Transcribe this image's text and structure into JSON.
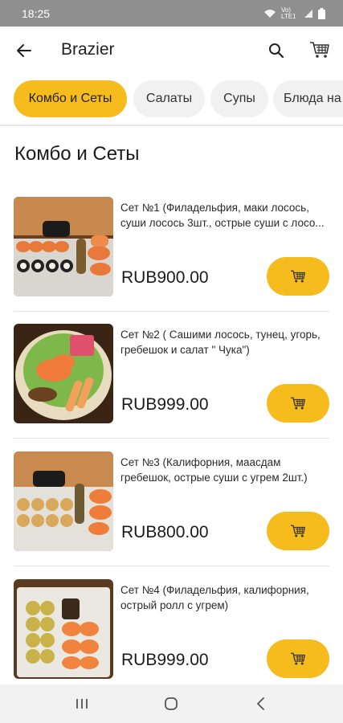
{
  "status": {
    "time": "18:25",
    "network": "Vo) LTE1"
  },
  "header": {
    "title": "Brazier"
  },
  "categories": [
    {
      "label": "Комбо и Сеты",
      "active": true
    },
    {
      "label": "Салаты",
      "active": false
    },
    {
      "label": "Супы",
      "active": false
    },
    {
      "label": "Блюда на",
      "active": false
    }
  ],
  "section": {
    "title": "Комбо и Сеты"
  },
  "products": [
    {
      "name": "Сет №1 (Филадельфия, маки лосось, суши лосось 3шт., острые суши с лосо...",
      "price": "RUB900.00"
    },
    {
      "name": "Сет №2 ( Сашими лосось, тунец, угорь, гребешок и салат \" Чука\")",
      "price": "RUB999.00"
    },
    {
      "name": "Сет №3 (Калифорния, маасдам гребешок, острые суши с угрем 2шт.)",
      "price": "RUB800.00"
    },
    {
      "name": "Сет №4 (Филадельфия, калифорния, острый ролл с угрем)",
      "price": "RUB999.00"
    }
  ],
  "colors": {
    "accent": "#f6bc1d",
    "statusbar": "#8f8f8f"
  }
}
